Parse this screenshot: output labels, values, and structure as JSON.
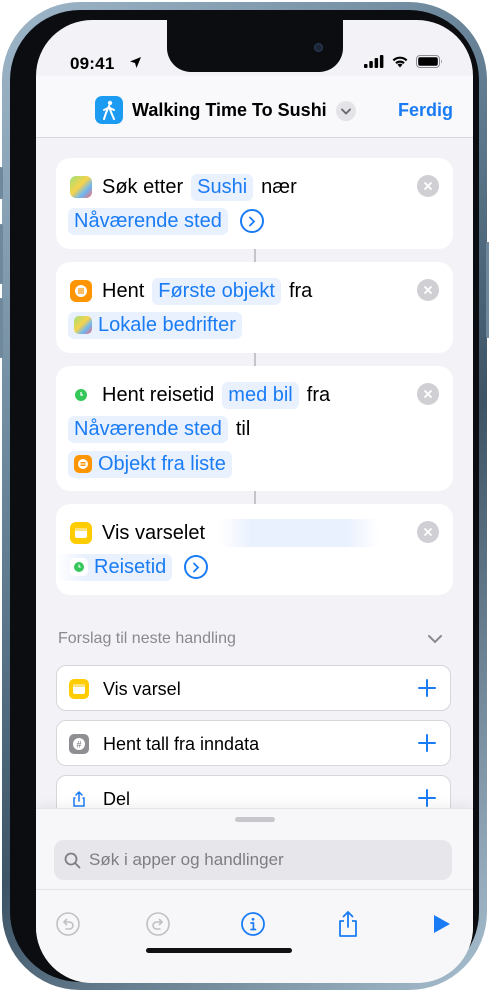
{
  "status_bar": {
    "time": "09:41"
  },
  "nav": {
    "title": "Walking Time To Sushi",
    "done_label": "Ferdig"
  },
  "actions": [
    {
      "rows": [
        [
          "Søk etter",
          "Sushi",
          "nær"
        ],
        [
          "Nåværende sted"
        ]
      ]
    },
    {
      "rows": [
        [
          "Hent",
          "Første objekt",
          "fra"
        ],
        [
          "Lokale bedrifter"
        ]
      ]
    },
    {
      "rows": [
        [
          "Hent reisetid",
          "med bil",
          "fra"
        ],
        [
          "Nåværende sted",
          "til"
        ],
        [
          "Objekt fra liste"
        ]
      ]
    },
    {
      "rows": [
        [
          "Vis varselet"
        ],
        [
          "Reisetid"
        ]
      ]
    }
  ],
  "a1": {
    "label": "Søk etter",
    "query": "Sushi",
    "near": "nær",
    "location": "Nåværende sted"
  },
  "a2": {
    "label": "Hent",
    "item": "Første objekt",
    "from": "fra",
    "source": "Lokale bedrifter"
  },
  "a3": {
    "label": "Hent reisetid",
    "mode": "med bil",
    "from": "fra",
    "origin": "Nåværende sted",
    "to": "til",
    "destination": "Objekt fra liste"
  },
  "a4": {
    "label": "Vis varselet",
    "variable": "Reisetid"
  },
  "suggestions": {
    "header": "Forslag til neste handling",
    "items": [
      {
        "label": "Vis varsel",
        "icon": "notification-icon"
      },
      {
        "label": "Hent tall fra inndata",
        "icon": "number-icon"
      },
      {
        "label": "Del",
        "icon": "share-icon"
      }
    ]
  },
  "search": {
    "placeholder": "Søk i apper og handlinger"
  },
  "colors": {
    "accent": "#1a7cf5",
    "background": "#f2f2f7",
    "token_bg": "#eaf1fe"
  }
}
